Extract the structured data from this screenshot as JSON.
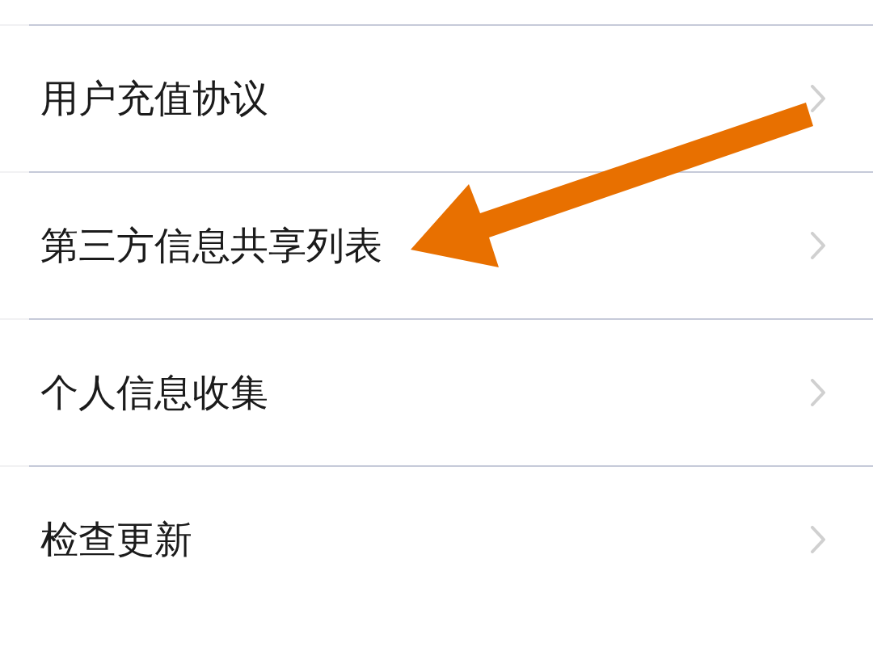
{
  "menu": {
    "items": [
      {
        "label": "用户充值协议"
      },
      {
        "label": "第三方信息共享列表"
      },
      {
        "label": "个人信息收集"
      },
      {
        "label": "检查更新"
      }
    ]
  }
}
